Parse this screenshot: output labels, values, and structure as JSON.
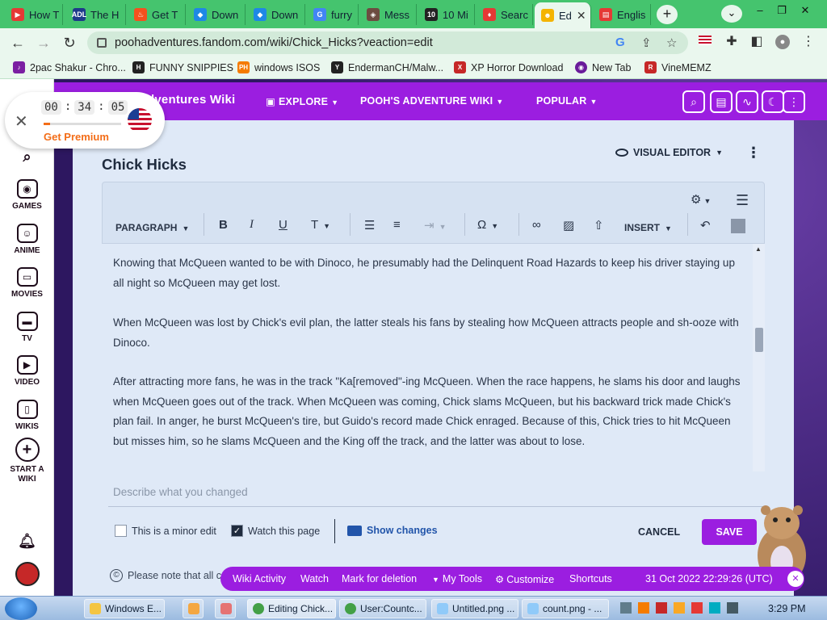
{
  "browser": {
    "tabs": [
      {
        "label": "How T",
        "icon": "youtube-icon",
        "color": "#e53935"
      },
      {
        "label": "The H",
        "icon": "adl-icon",
        "color": "#1e3a8a"
      },
      {
        "label": "Get T",
        "icon": "flame-icon",
        "color": "#f4511e"
      },
      {
        "label": "Down",
        "icon": "puzzle-icon",
        "color": "#1e88e5"
      },
      {
        "label": "Down",
        "icon": "puzzle-icon",
        "color": "#1e88e5"
      },
      {
        "label": "furry",
        "icon": "google-icon",
        "color": "#4285f4"
      },
      {
        "label": "Mess",
        "icon": "game-icon",
        "color": "#6d4c41"
      },
      {
        "label": "10 Mi",
        "icon": "ten-icon",
        "color": "#222222"
      },
      {
        "label": "Searc",
        "icon": "fandom-icon",
        "color": "#e53935"
      },
      {
        "label": "Ed",
        "icon": "pooh-icon",
        "color": "#f4b400",
        "active": true
      },
      {
        "label": "Englis",
        "icon": "book-icon",
        "color": "#e53935"
      }
    ],
    "new_tab_label": "+",
    "url": "poohadventures.fandom.com/wiki/Chick_Hicks?veaction=edit",
    "bookmarks": [
      {
        "label": "2pac Shakur - Chro...",
        "icon": "2pac-icon",
        "color": "#7b1fa2"
      },
      {
        "label": "FUNNY SNIPPIES",
        "icon": "snip-icon",
        "color": "#222222"
      },
      {
        "label": "windows ISOS",
        "icon": "ph-icon",
        "color": "#f57c00"
      },
      {
        "label": "EndermanCH/Malw...",
        "icon": "github-icon",
        "color": "#222222"
      },
      {
        "label": "XP Horror Download",
        "icon": "x-icon",
        "color": "#c62828"
      },
      {
        "label": "New Tab",
        "icon": "globe-icon",
        "color": "#6a1b9a"
      },
      {
        "label": "VineMEMZ",
        "icon": "r-icon",
        "color": "#c62828"
      }
    ]
  },
  "timer": {
    "hours": "00",
    "minutes": "34",
    "seconds": "05",
    "premium_label": "Get Premium",
    "progress": 0.08
  },
  "fandom": {
    "wiki_name": "Adventures Wiki",
    "nav": [
      {
        "label": "EXPLORE"
      },
      {
        "label": "POOH'S ADVENTURE WIKI"
      },
      {
        "label": "POPULAR"
      }
    ],
    "rail": [
      {
        "label": "GAMES",
        "icon": "gamepad-icon"
      },
      {
        "label": "ANIME",
        "icon": "anime-icon"
      },
      {
        "label": "MOVIES",
        "icon": "clapper-icon"
      },
      {
        "label": "TV",
        "icon": "tv-icon"
      },
      {
        "label": "VIDEO",
        "icon": "play-icon"
      },
      {
        "label": "WIKIS",
        "icon": "book-icon"
      },
      {
        "label": "START A WIKI",
        "icon": "plus-circle-icon"
      }
    ]
  },
  "editor": {
    "page_title": "Chick Hicks",
    "visual_editor_label": "VISUAL EDITOR",
    "toolbar": {
      "paragraph_label": "PARAGRAPH",
      "insert_label": "INSERT"
    },
    "paragraphs": {
      "p1": "Knowing that McQueen wanted to be with Dinoco, he presumably had the Delinquent Road Hazards to keep his driver staying up all night so McQueen may get lost.",
      "p2": "When McQueen was lost by Chick's evil plan, the latter steals his fans by stealing how McQueen attracts people and sh-ooze with Dinoco.",
      "p3": "After attracting more fans, he was in the track \"Ka[removed\"-ing McQueen. When the race happens, he slams his door and laughs when McQueen goes out of the track. When McQueen was coming, Chick slams McQueen, but his backward trick made Chick's plan fail. In anger, he burst McQueen's tire, but Guido's record made Chick enraged. Because of this, Chick tries to hit McQueen but misses him, so he slams McQueen and the King off the track, and the latter was about to lose."
    },
    "summary_placeholder": "Describe what you changed",
    "minor_edit_label": "This is a minor edit",
    "minor_edit_checked": false,
    "watch_label": "Watch this page",
    "watch_checked": true,
    "show_changes_label": "Show changes",
    "cancel_label": "CANCEL",
    "save_label": "SAVE",
    "notice_text": "Please note that all c"
  },
  "tools": {
    "items": [
      "Wiki Activity",
      "Watch",
      "Mark for deletion",
      "My Tools",
      "Customize",
      "Shortcuts"
    ],
    "timestamp": "31 Oct 2022 22:29:26 (UTC)"
  },
  "taskbar": {
    "items": [
      {
        "label": "Windows E...",
        "icon": "folder-icon",
        "color": "#f4c542"
      },
      {
        "label": "",
        "icon": "media-icon",
        "color": "#f4a742"
      },
      {
        "label": "",
        "icon": "paint-icon",
        "color": "#e57373"
      },
      {
        "label": "Editing Chick...",
        "icon": "chrome-icon",
        "color": "#43a047"
      },
      {
        "label": "User:Countc...",
        "icon": "chrome-icon",
        "color": "#43a047"
      },
      {
        "label": "Untitled.png ...",
        "icon": "paint-icon",
        "color": "#90caf9"
      },
      {
        "label": "count.png - ...",
        "icon": "paint-icon",
        "color": "#90caf9"
      }
    ],
    "clock": "3:29 PM"
  },
  "colors": {
    "fandom_purple": "#9b1ee0",
    "chrome_green": "#45c46e",
    "premium_orange": "#f36d18",
    "editor_bg": "#dfe9f7"
  }
}
